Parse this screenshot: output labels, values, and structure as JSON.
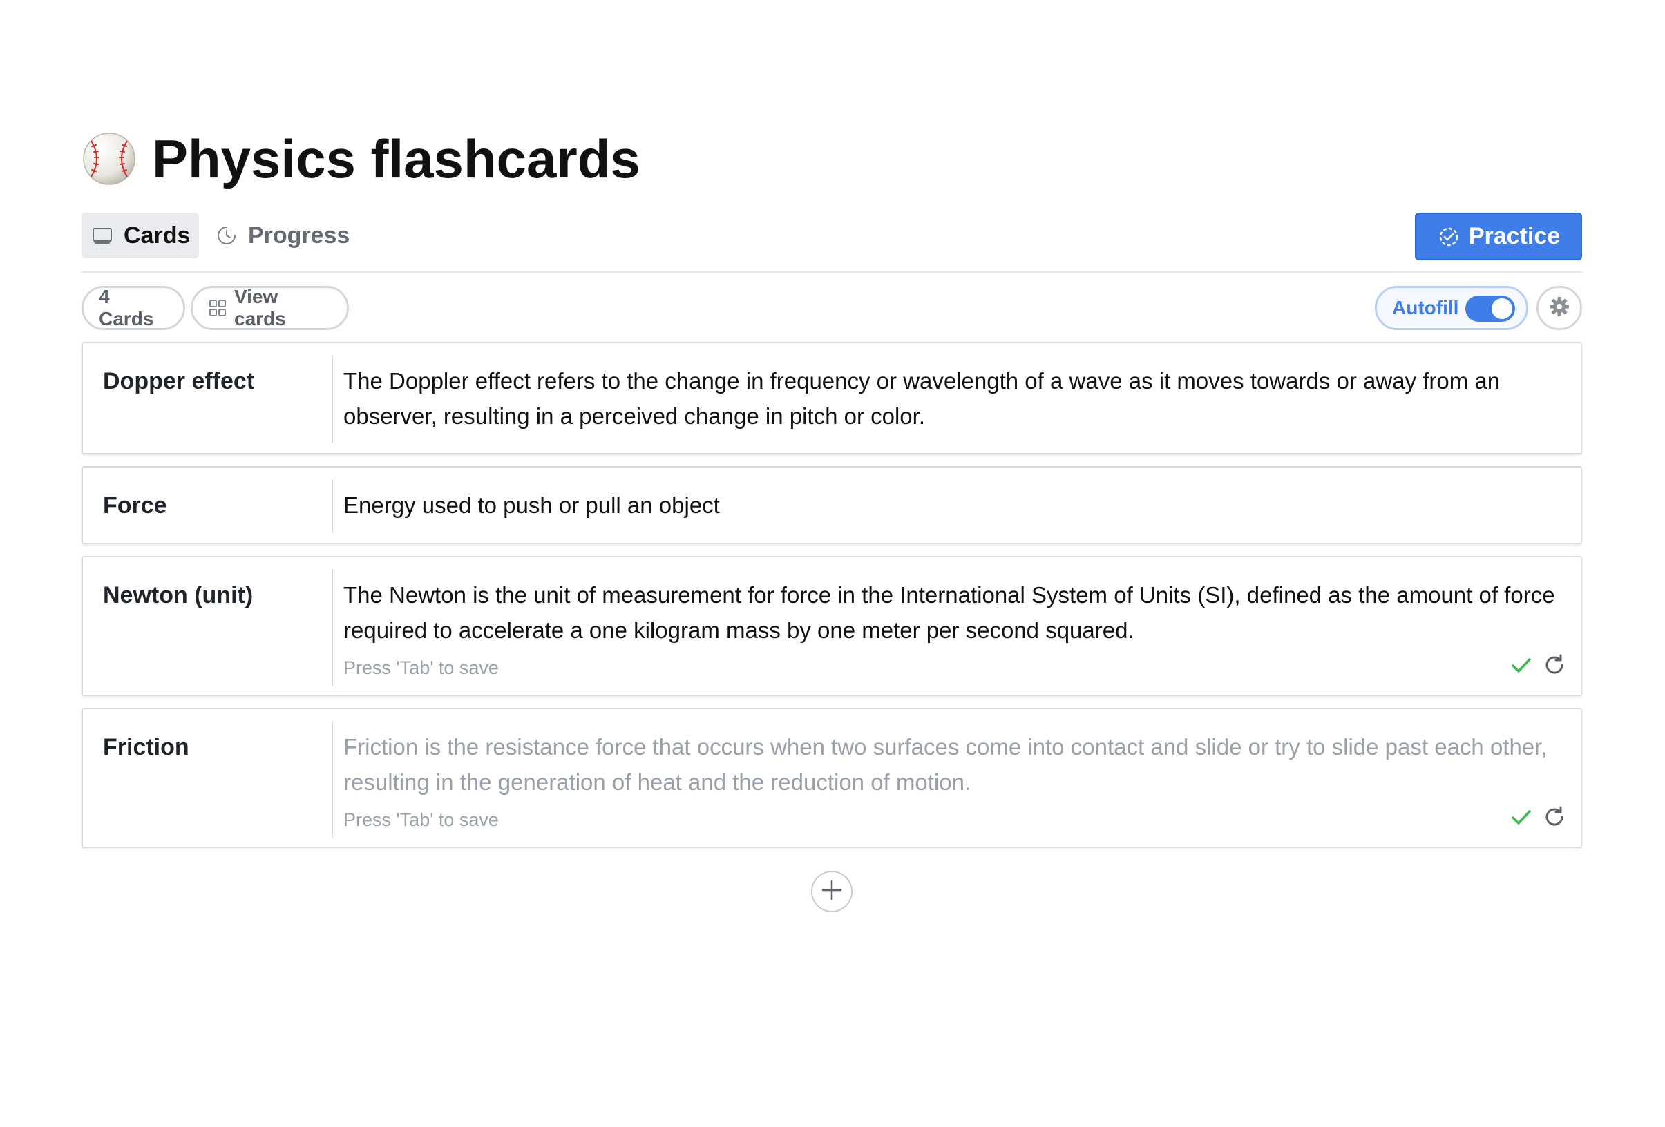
{
  "header": {
    "emoji_icon": "baseball-icon",
    "title": "Physics flashcards"
  },
  "tabs": [
    {
      "label": "Cards",
      "icon": "card-icon",
      "active": true
    },
    {
      "label": "Progress",
      "icon": "clock-icon",
      "active": false
    }
  ],
  "practice": {
    "label": "Practice",
    "icon": "practice-icon"
  },
  "toolbar": {
    "count_label": "4 Cards",
    "view_label": "View cards",
    "autofill_label": "Autofill",
    "autofill_on": true
  },
  "cards": [
    {
      "term": "Dopper effect",
      "definition": "The Doppler effect refers to the change in frequency or wavelength of a wave as it moves towards or away from an observer, resulting in a perceived change in pitch or color.",
      "placeholder": false,
      "hint": ""
    },
    {
      "term": "Force",
      "definition": "Energy used to push or pull an object",
      "placeholder": false,
      "hint": ""
    },
    {
      "term": "Newton (unit)",
      "definition": "The Newton is the unit of measurement for force in the International System of Units (SI), defined as the amount of force required to accelerate a one kilogram mass by one meter per second squared.",
      "placeholder": false,
      "hint": "Press 'Tab' to save"
    },
    {
      "term": "Friction",
      "definition": "Friction is the resistance force that occurs when two surfaces come into contact and slide or try to slide past each other, resulting in the generation of heat and the reduction of motion.",
      "placeholder": true,
      "hint": "Press 'Tab' to save"
    }
  ],
  "colors": {
    "accent": "#3f7ee8",
    "check": "#3fb950",
    "muted": "#9aa0a8"
  }
}
